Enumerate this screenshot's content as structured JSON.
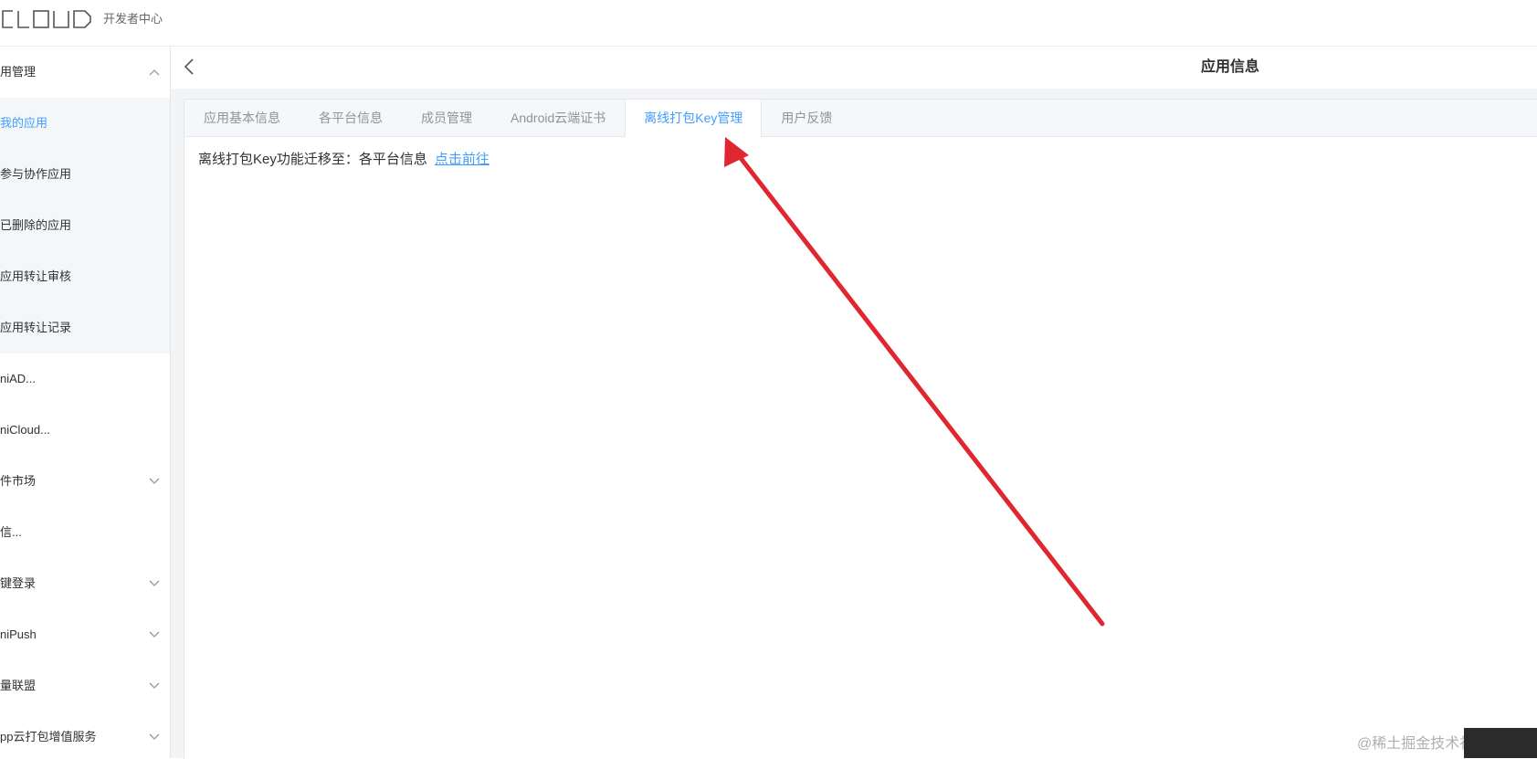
{
  "header": {
    "logo_text": "CLOUD",
    "logo_subtitle": "开发者中心"
  },
  "sidebar": {
    "items": [
      {
        "label": "用管理",
        "chevron": "up"
      },
      {
        "label": "我的应用",
        "sub": true,
        "active": true
      },
      {
        "label": "参与协作应用",
        "sub": true
      },
      {
        "label": "已删除的应用",
        "sub": true
      },
      {
        "label": "应用转让审核",
        "sub": true
      },
      {
        "label": "应用转让记录",
        "sub": true
      },
      {
        "label": "niAD..."
      },
      {
        "label": "niCloud..."
      },
      {
        "label": "件市场",
        "chevron": "down"
      },
      {
        "label": "信..."
      },
      {
        "label": "键登录",
        "chevron": "down"
      },
      {
        "label": "niPush",
        "chevron": "down"
      },
      {
        "label": "量联盟",
        "chevron": "down"
      },
      {
        "label": "pp云打包增值服务",
        "chevron": "down"
      }
    ]
  },
  "page": {
    "title": "应用信息",
    "back_icon": "chevron-left-icon"
  },
  "tabs": [
    {
      "label": "应用基本信息",
      "active": false
    },
    {
      "label": "各平台信息",
      "active": false
    },
    {
      "label": "成员管理",
      "active": false
    },
    {
      "label": "Android云端证书",
      "active": false
    },
    {
      "label": "离线打包Key管理",
      "active": true
    },
    {
      "label": "用户反馈",
      "active": false
    }
  ],
  "content": {
    "message": "离线打包Key功能迁移至：各平台信息",
    "link": "点击前往"
  },
  "annotation": {
    "color": "#e0262f"
  },
  "watermark": "@稀土掘金技术社区",
  "colors": {
    "accent": "#409eff",
    "sidebar_sub_bg": "#f5f6f8"
  }
}
